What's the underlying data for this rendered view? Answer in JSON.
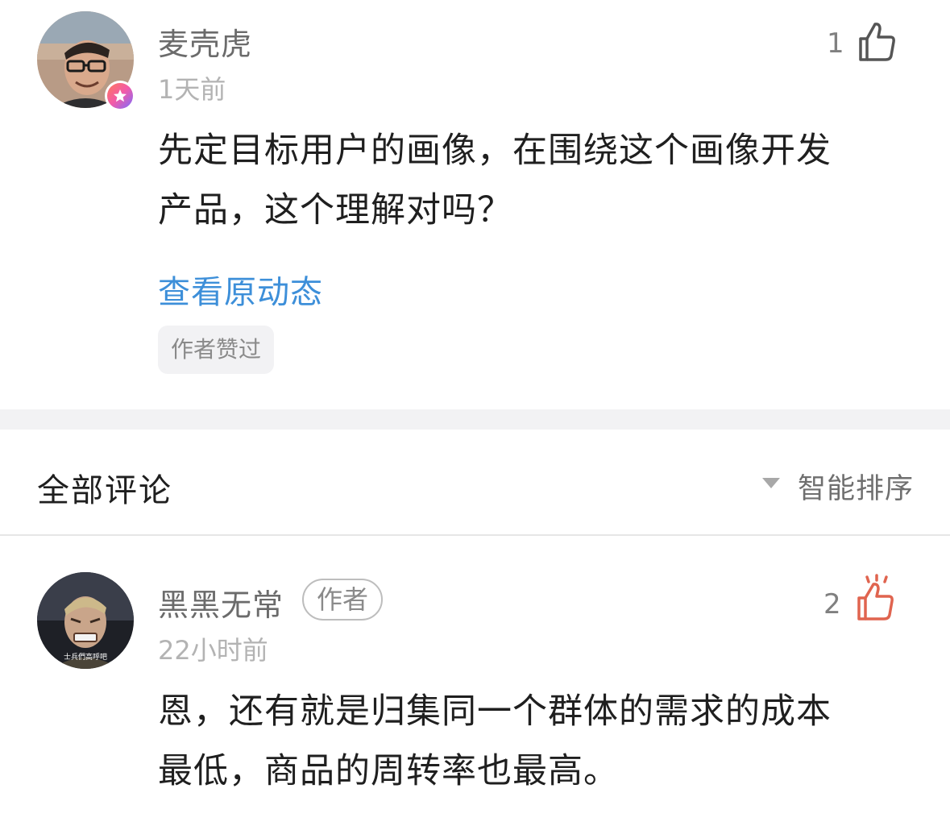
{
  "top_comment": {
    "username": "麦壳虎",
    "time": "1天前",
    "like_count": "1",
    "content_line1": "先定目标用户的画像，在围绕这个画像开发",
    "content_line2": "产品，这个理解对吗？",
    "view_original": "查看原动态",
    "author_liked": "作者赞过"
  },
  "comments_section": {
    "title": "全部评论",
    "sort_label": "智能排序"
  },
  "reply": {
    "username": "黑黑无常",
    "author_tag": "作者",
    "time": "22小时前",
    "like_count": "2",
    "content_line1": "恩，还有就是归集同一个群体的需求的成本",
    "content_line2": "最低，商品的周转率也最高。",
    "avatar_caption": "士兵們高呼吧"
  },
  "colors": {
    "link": "#3d8fd9",
    "liked_icon": "#e0644f",
    "divider": "#f2f2f4"
  }
}
